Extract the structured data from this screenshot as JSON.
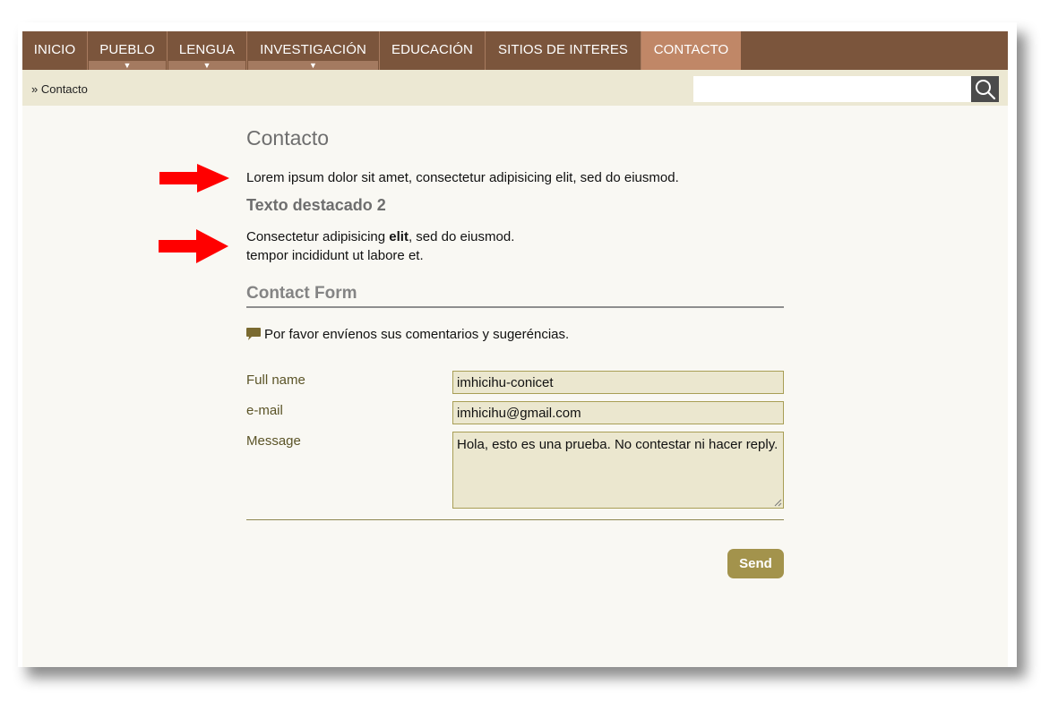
{
  "nav": {
    "items": [
      {
        "label": "INICIO",
        "has_dropdown": false,
        "active": false
      },
      {
        "label": "PUEBLO",
        "has_dropdown": true,
        "active": false
      },
      {
        "label": "LENGUA",
        "has_dropdown": true,
        "active": false
      },
      {
        "label": "INVESTIGACIÓN",
        "has_dropdown": true,
        "active": false
      },
      {
        "label": "EDUCACIÓN",
        "has_dropdown": false,
        "active": false
      },
      {
        "label": "SITIOS DE INTERES",
        "has_dropdown": false,
        "active": false
      },
      {
        "label": "CONTACTO",
        "has_dropdown": false,
        "active": true
      }
    ],
    "dropdown_glyph": "▼"
  },
  "breadcrumb": "» Contacto",
  "search": {
    "value": "",
    "placeholder": "",
    "icon": "search-icon"
  },
  "content": {
    "title": "Contacto",
    "paragraph1": "Lorem ipsum dolor sit amet, consectetur adipisicing elit, sed do eiusmod.",
    "subtitle": "Texto destacado 2",
    "paragraph2_line1_pre": "Consectetur adipisicing ",
    "paragraph2_line1_bold": "elit",
    "paragraph2_line1_post": ", sed do eiusmod.",
    "paragraph2_line2": "tempor incididunt ut labore et."
  },
  "form": {
    "title": "Contact Form",
    "note": "Por favor envíenos sus comentarios y sugeréncias.",
    "fields": {
      "full_name": {
        "label": "Full name",
        "value": "imhicihu-conicet"
      },
      "email": {
        "label": "e-mail",
        "value": "imhicihu@gmail.com"
      },
      "message": {
        "label": "Message",
        "value": "Hola, esto es una prueba. No contestar ni hacer reply."
      }
    },
    "send_label": "Send"
  },
  "colors": {
    "nav_bg": "#7b553c",
    "nav_active": "#c08767",
    "crumb_bg": "#ece8d3",
    "page_bg": "#f9f8f3",
    "field_bg": "#ebe7cf",
    "send_bg": "#a3934c",
    "arrow": "#ff0000"
  }
}
